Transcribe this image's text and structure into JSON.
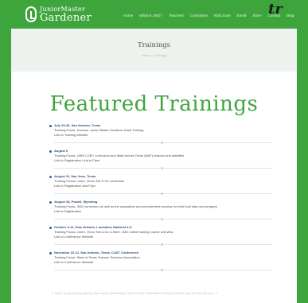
{
  "site": {
    "logo_line1": "JuniorMaster",
    "logo_line2": "Gardener",
    "tagline_fragment": "tr"
  },
  "nav": {
    "items": [
      "Home",
      "What is JMG?",
      "Teachers",
      "Curriculum",
      "Kids Zone",
      "Enroll",
      "Store",
      "Contact",
      "Blog"
    ]
  },
  "hero": {
    "title": "Trainings",
    "breadcrumb": "Home  >  Trainings"
  },
  "main": {
    "heading": "Featured Trainings",
    "trainings": [
      {
        "title": "July 29-30, San Antonio, Texas",
        "desc": "Training Focus: Summer Junior Master Gardener Adult Training",
        "link": "Link to Training Website"
      },
      {
        "title": "August 9",
        "desc": "Training Focus: (JMG LGEC curriculum and Walk Across Texas (WAT) lessons and activities",
        "link": "Link to Registration  Link to Flyer"
      },
      {
        "title": "August 11, San Jose, Texas",
        "desc": "Training Focus: Learn, Grow, Eat & Go curriculum",
        "link": "Link to Registration  and Flyer"
      },
      {
        "title": "August 18, Powell, Wyoming",
        "desc": "Training Focus: JMG curriculum as well as the acquisition and procurement process for both host sites and program",
        "link": "Link to Registration"
      },
      {
        "title": "October 9-12, New Orleans, Louisiana, National 4-H",
        "desc": "Training Focus: Learn, Grow, Eat & Go & More: JMG online training course overview",
        "link": "Link to Conference Website"
      },
      {
        "title": "November 10-12, San Antonio, Texas, CAST Conference",
        "desc": "Training Focus: State of Texas Science Teachers Association",
        "link": "Link to Conference Website"
      }
    ],
    "footnote": "*I. Have an upcoming training that needs advertising? Send us the information through this link and we'll do the rest. *I"
  },
  "colors": {
    "brand_green": "#3ea53d",
    "hero_bg": "#eef2ee",
    "heading_green": "#3ea53d"
  }
}
